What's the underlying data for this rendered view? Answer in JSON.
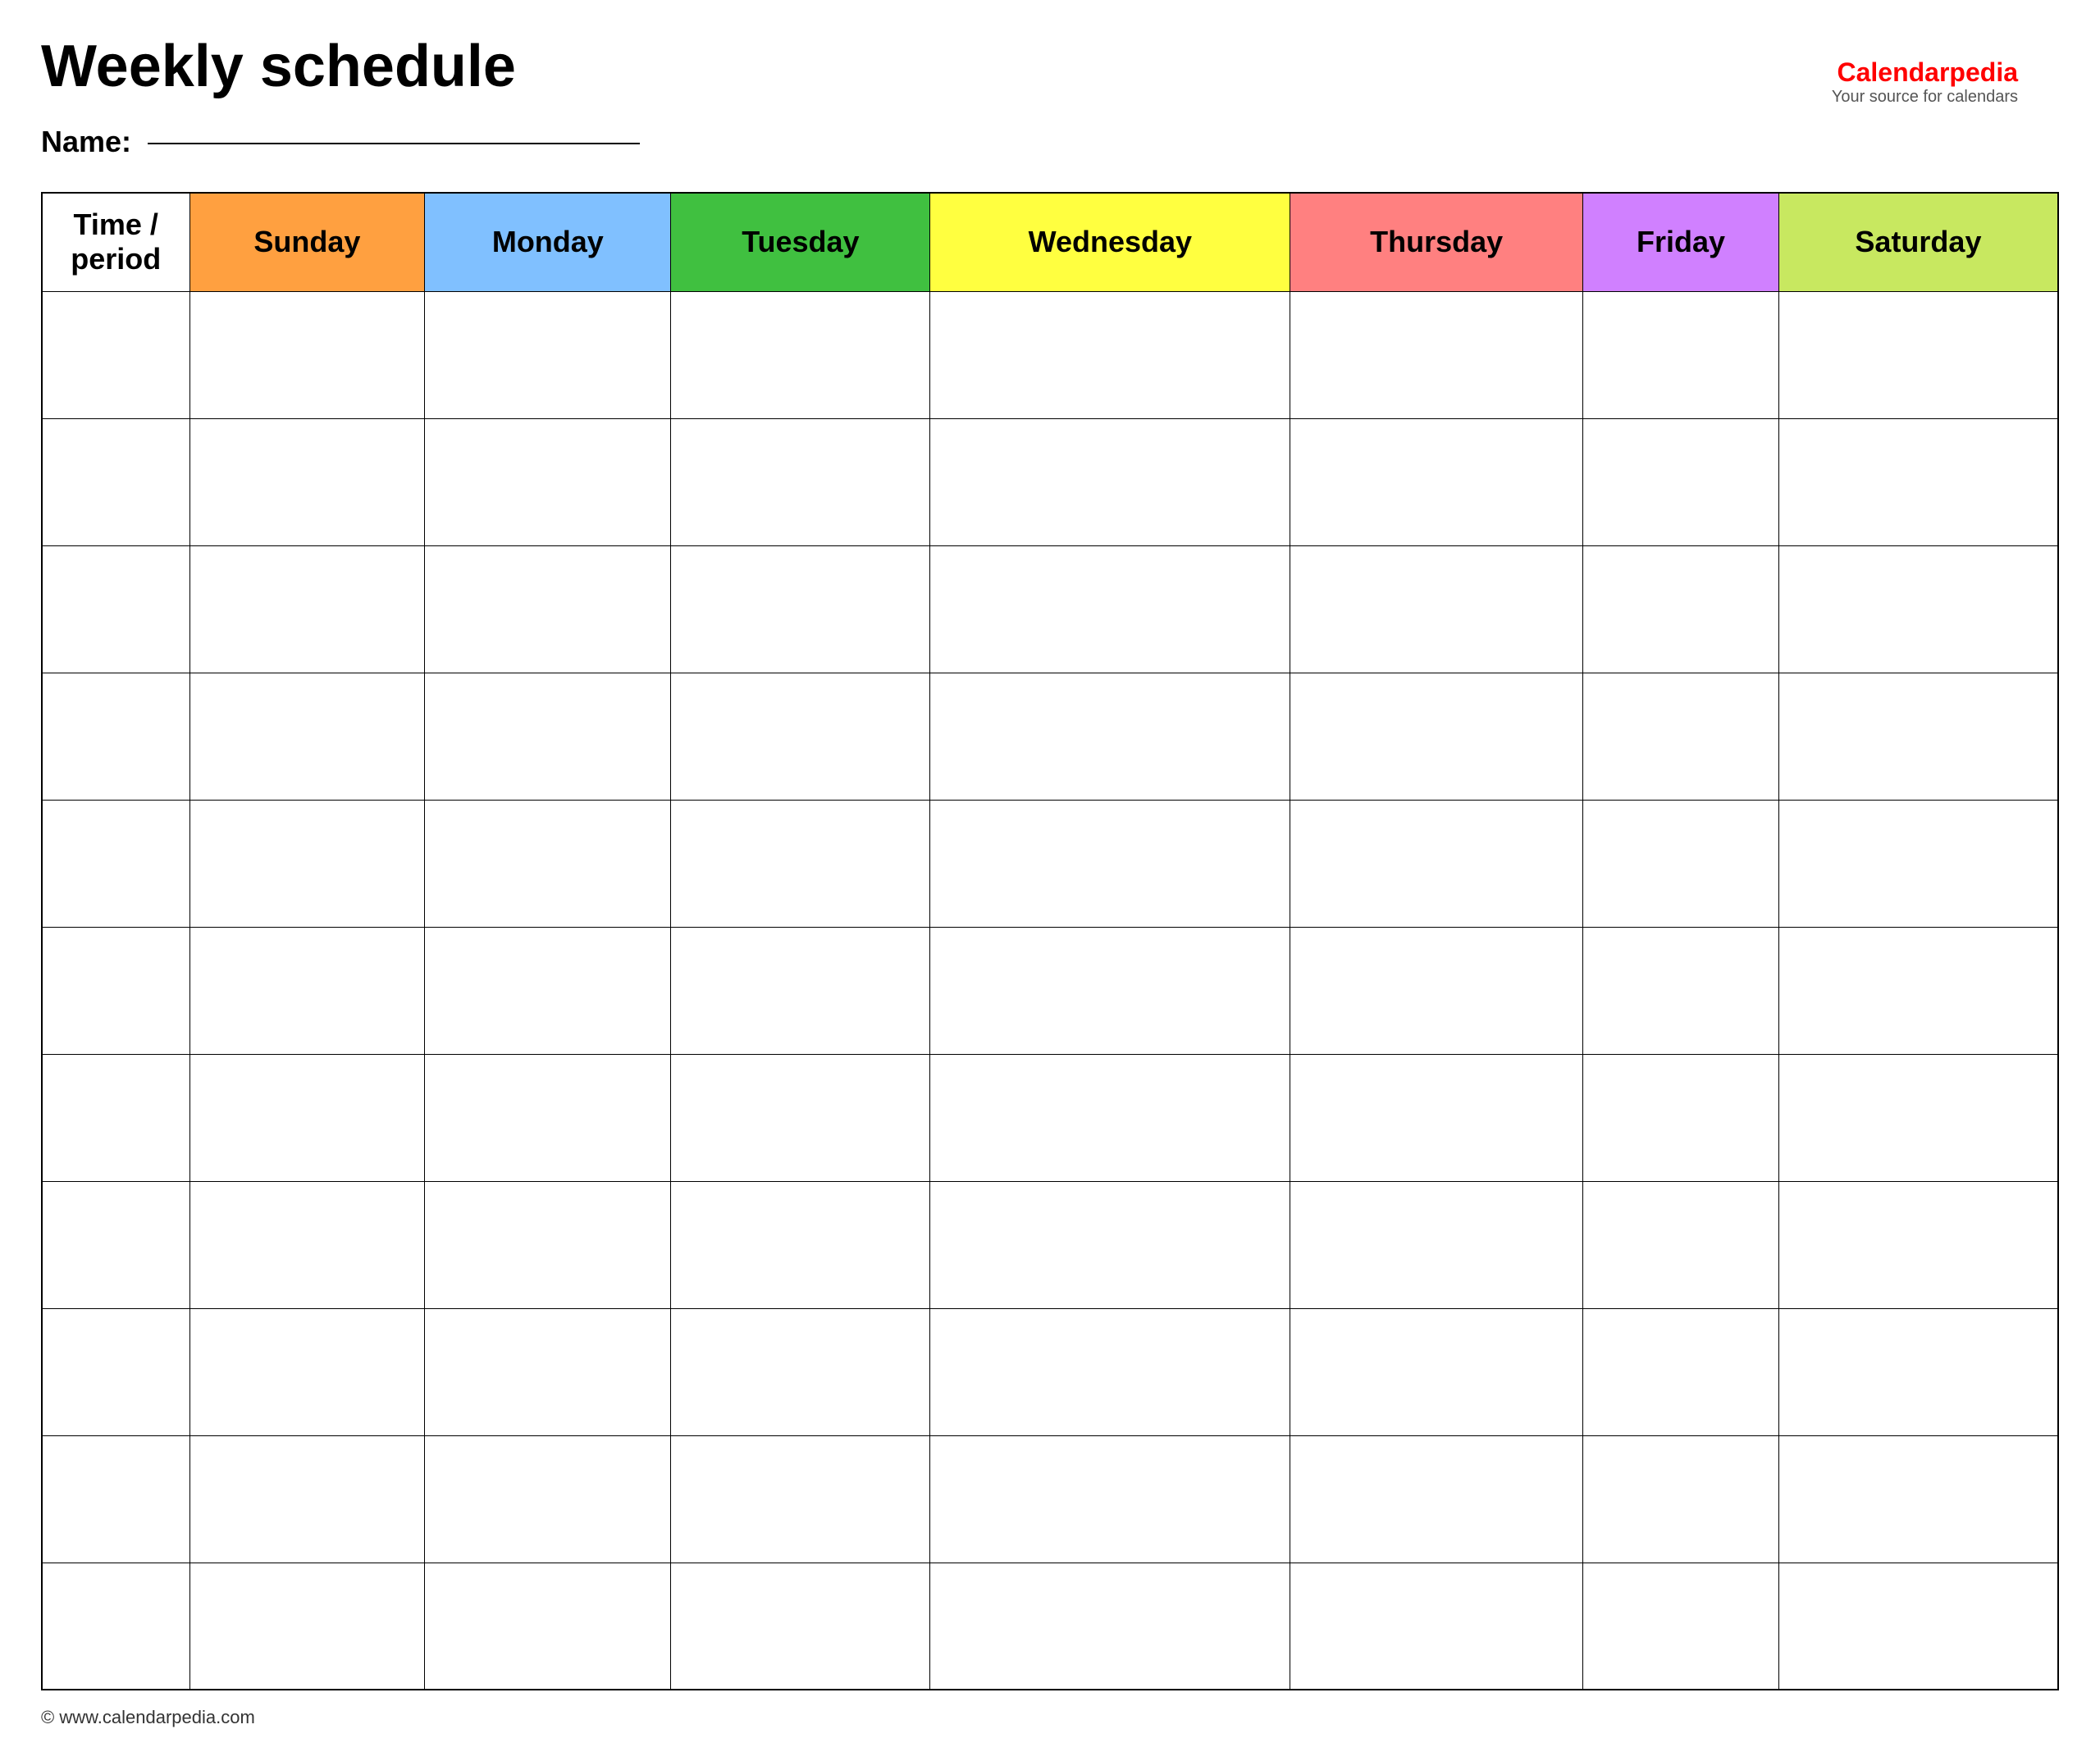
{
  "page": {
    "title": "Weekly schedule",
    "name_label": "Name:",
    "footer_text": "© www.calendarpedia.com"
  },
  "logo": {
    "brand_part1": "Calendar",
    "brand_part2": "pedia",
    "tagline": "Your source for calendars"
  },
  "table": {
    "headers": [
      {
        "id": "time",
        "label": "Time / period",
        "class": "col-time header-time"
      },
      {
        "id": "sunday",
        "label": "Sunday",
        "class": "col-sunday"
      },
      {
        "id": "monday",
        "label": "Monday",
        "class": "col-monday"
      },
      {
        "id": "tuesday",
        "label": "Tuesday",
        "class": "col-tuesday"
      },
      {
        "id": "wednesday",
        "label": "Wednesday",
        "class": "col-wednesday"
      },
      {
        "id": "thursday",
        "label": "Thursday",
        "class": "col-thursday"
      },
      {
        "id": "friday",
        "label": "Friday",
        "class": "col-friday"
      },
      {
        "id": "saturday",
        "label": "Saturday",
        "class": "col-saturday"
      }
    ],
    "row_count": 11
  }
}
